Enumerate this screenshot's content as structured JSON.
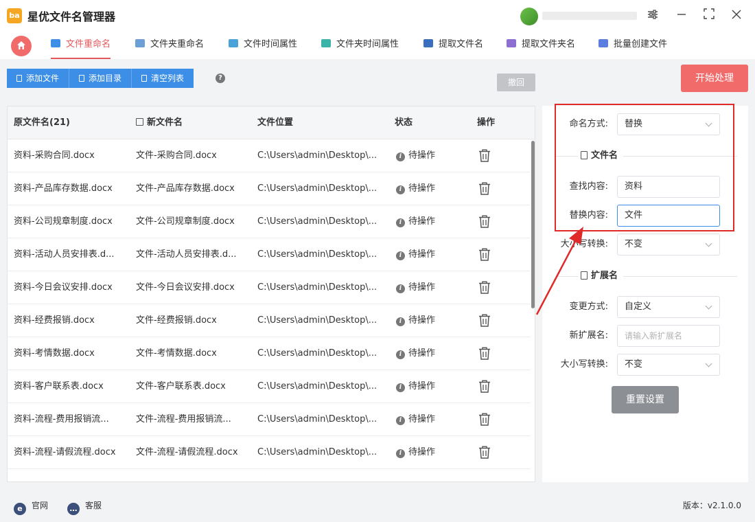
{
  "app": {
    "title": "星优文件名管理器",
    "logo_text": "ba"
  },
  "tabs": [
    {
      "label": "文件重命名",
      "active": true,
      "icon": "rename-icon",
      "color": "#3d8ee6"
    },
    {
      "label": "文件夹重命名",
      "active": false,
      "icon": "folder-rename-icon",
      "color": "#6b9fd6"
    },
    {
      "label": "文件时间属性",
      "active": false,
      "icon": "file-time-icon",
      "color": "#4aa3d8"
    },
    {
      "label": "文件夹时间属性",
      "active": false,
      "icon": "folder-time-icon",
      "color": "#3bb3a8"
    },
    {
      "label": "提取文件名",
      "active": false,
      "icon": "extract-file-icon",
      "color": "#3a6fc0"
    },
    {
      "label": "提取文件夹名",
      "active": false,
      "icon": "extract-folder-icon",
      "color": "#8c6fd1"
    },
    {
      "label": "批量创建文件",
      "active": false,
      "icon": "batch-create-icon",
      "color": "#5a7de0"
    }
  ],
  "toolbar": {
    "add_file": "添加文件",
    "add_dir": "添加目录",
    "clear_list": "清空列表",
    "help": "?",
    "undo": "撤回",
    "start": "开始处理"
  },
  "table": {
    "headers": {
      "original": "原文件名(21)",
      "new": "新文件名",
      "location": "文件位置",
      "status": "状态",
      "action": "操作"
    },
    "rows": [
      {
        "original": "资料-采购合同.docx",
        "new": "文件-采购合同.docx",
        "location": "C:\\Users\\admin\\Desktop\\...",
        "status": "待操作"
      },
      {
        "original": "资料-产品库存数据.docx",
        "new": "文件-产品库存数据.docx",
        "location": "C:\\Users\\admin\\Desktop\\...",
        "status": "待操作"
      },
      {
        "original": "资料-公司规章制度.docx",
        "new": "文件-公司规章制度.docx",
        "location": "C:\\Users\\admin\\Desktop\\...",
        "status": "待操作"
      },
      {
        "original": "资料-活动人员安排表.d...",
        "new": "文件-活动人员安排表.d...",
        "location": "C:\\Users\\admin\\Desktop\\...",
        "status": "待操作"
      },
      {
        "original": "资料-今日会议安排.docx",
        "new": "文件-今日会议安排.docx",
        "location": "C:\\Users\\admin\\Desktop\\...",
        "status": "待操作"
      },
      {
        "original": "资料-经费报销.docx",
        "new": "文件-经费报销.docx",
        "location": "C:\\Users\\admin\\Desktop\\...",
        "status": "待操作"
      },
      {
        "original": "资料-考情数据.docx",
        "new": "文件-考情数据.docx",
        "location": "C:\\Users\\admin\\Desktop\\...",
        "status": "待操作"
      },
      {
        "original": "资料-客户联系表.docx",
        "new": "文件-客户联系表.docx",
        "location": "C:\\Users\\admin\\Desktop\\...",
        "status": "待操作"
      },
      {
        "original": "资料-流程-费用报销流...",
        "new": "文件-流程-费用报销流...",
        "location": "C:\\Users\\admin\\Desktop\\...",
        "status": "待操作"
      },
      {
        "original": "资料-流程-请假流程.docx",
        "new": "文件-流程-请假流程.docx",
        "location": "C:\\Users\\admin\\Desktop\\...",
        "status": "待操作"
      }
    ]
  },
  "panel": {
    "naming_method_label": "命名方式:",
    "naming_method_value": "替换",
    "filename_section": "文件名",
    "find_label": "查找内容:",
    "find_value": "资料",
    "replace_label": "替换内容:",
    "replace_value": "文件",
    "case_label": "大小写转换:",
    "case_value": "不变",
    "ext_section": "扩展名",
    "change_method_label": "变更方式:",
    "change_method_value": "自定义",
    "new_ext_label": "新扩展名:",
    "new_ext_placeholder": "请输入新扩展名",
    "ext_case_label": "大小写转换:",
    "ext_case_value": "不变",
    "reset": "重置设置"
  },
  "footer": {
    "website": "官网",
    "support": "客服",
    "version": "版本：v2.1.0.0"
  },
  "colors": {
    "accent_red": "#f26b6b",
    "primary_blue": "#3d8ee6",
    "annotation_red": "#e02a2a"
  }
}
